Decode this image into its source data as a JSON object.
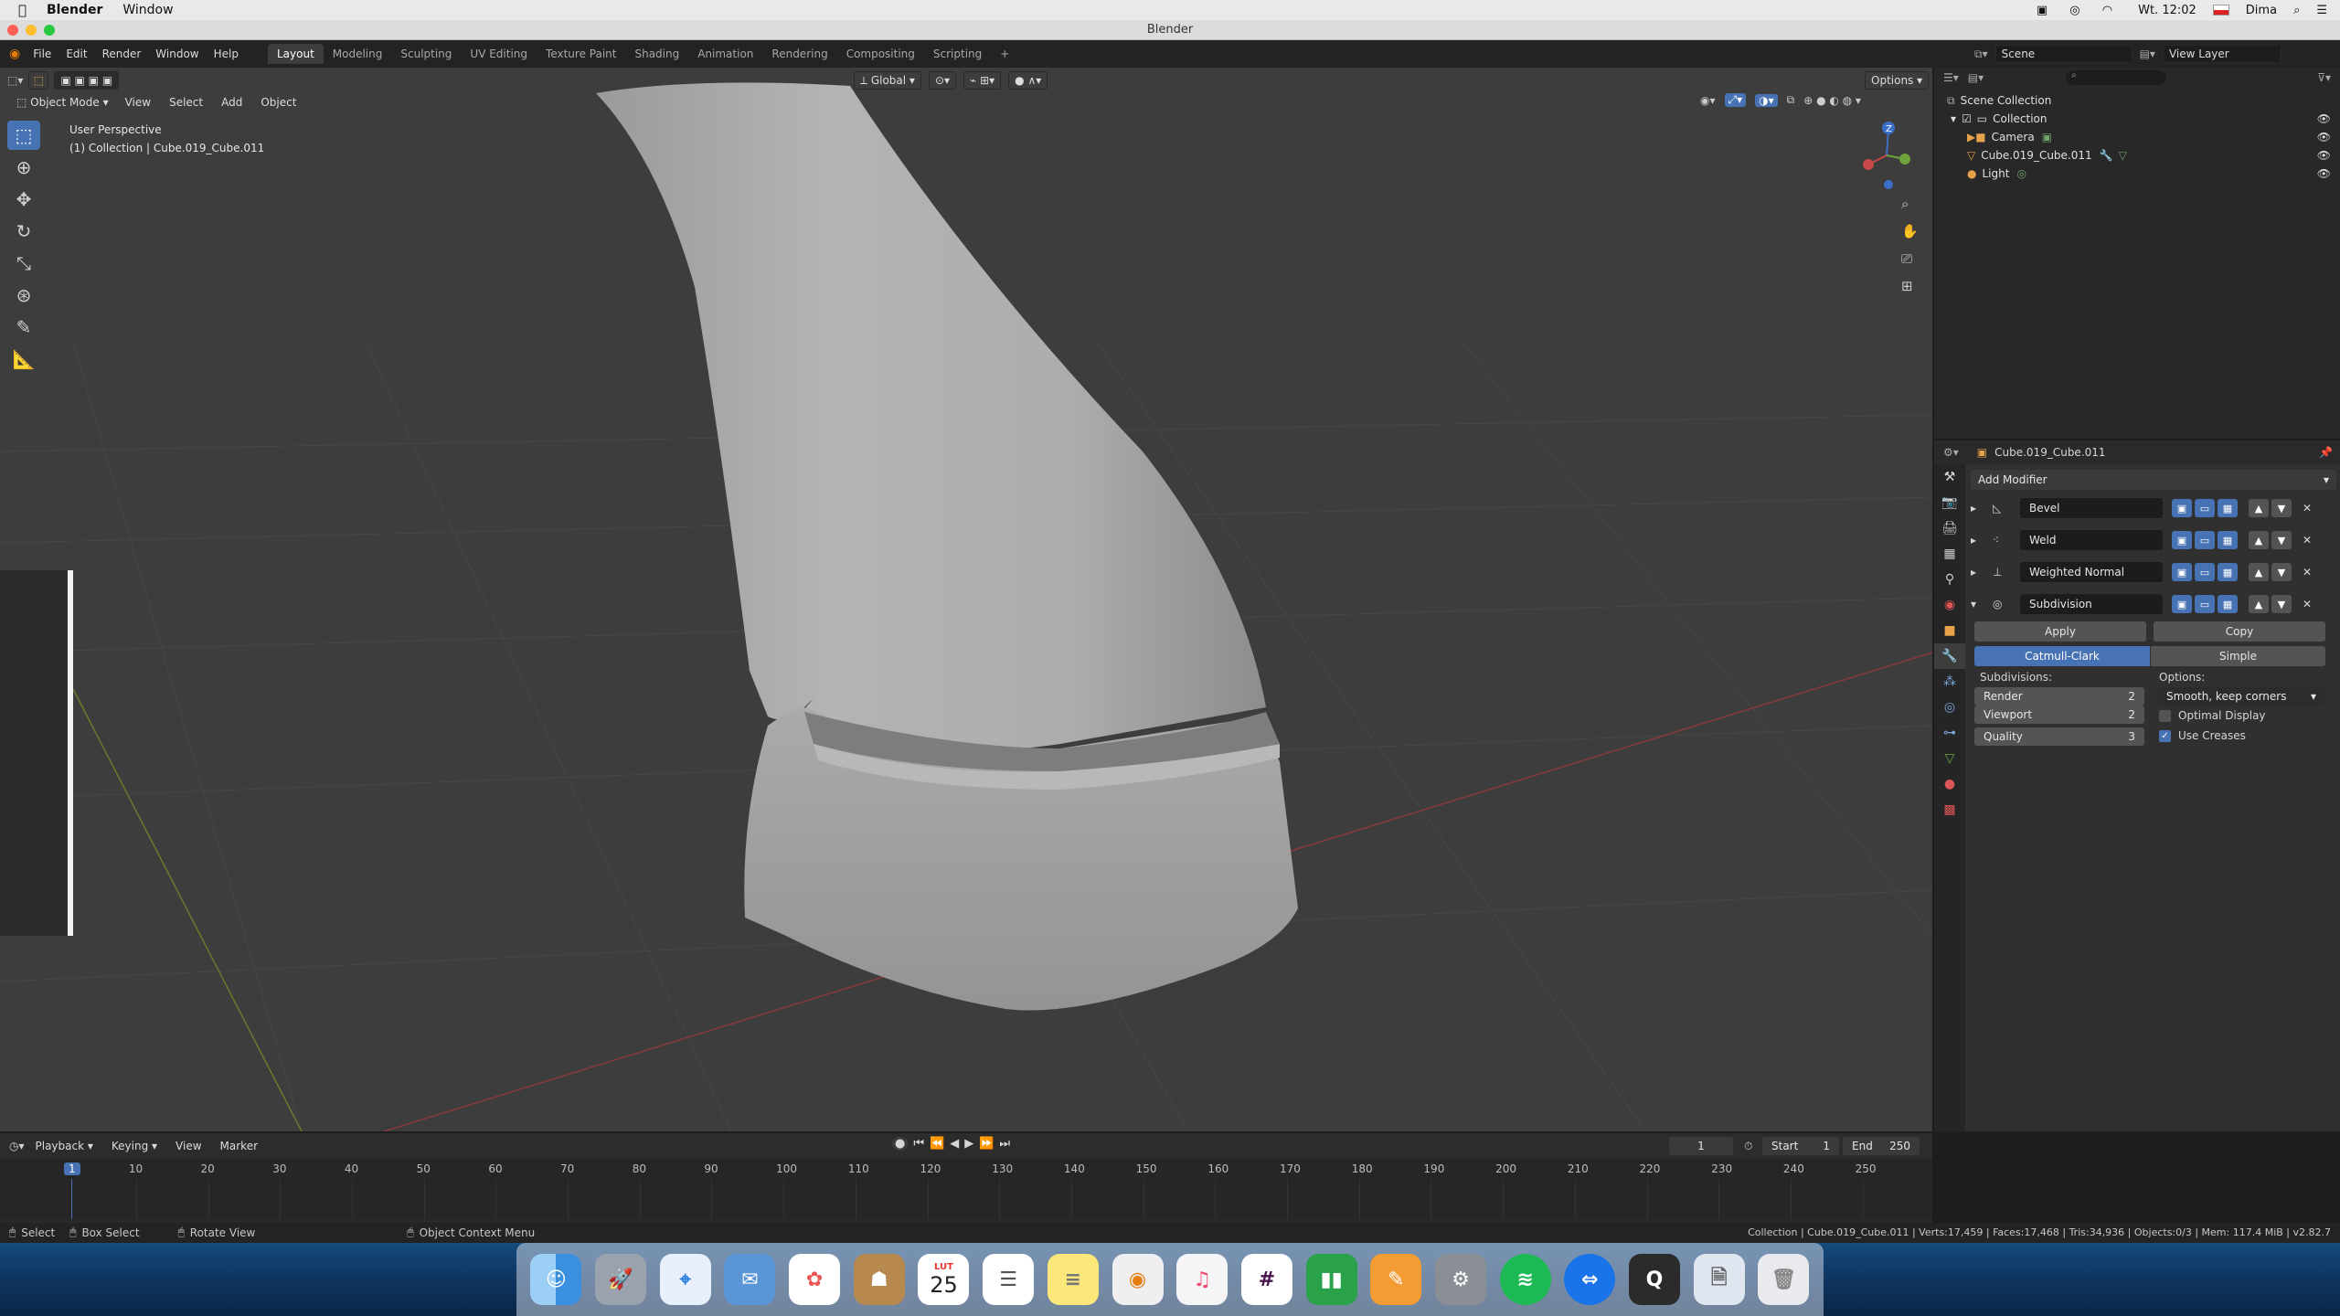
{
  "macos": {
    "app_name": "Blender",
    "menu": [
      "Window"
    ],
    "clock": "Wt. 12:02",
    "user": "Dima"
  },
  "window": {
    "title": "Blender"
  },
  "topbar": {
    "menus": [
      "File",
      "Edit",
      "Render",
      "Window",
      "Help"
    ],
    "workspaces": [
      "Layout",
      "Modeling",
      "Sculpting",
      "UV Editing",
      "Texture Paint",
      "Shading",
      "Animation",
      "Rendering",
      "Compositing",
      "Scripting",
      "+"
    ],
    "active_workspace": "Layout",
    "scene_label": "Scene",
    "view_layer_label": "View Layer"
  },
  "viewport": {
    "mode": "Object Mode",
    "menus": [
      "View",
      "Select",
      "Add",
      "Object"
    ],
    "transform_orientation": "Global",
    "options_label": "Options",
    "info_line1": "User Perspective",
    "info_line2": "(1) Collection | Cube.019_Cube.011",
    "gizmo_z": "Z"
  },
  "outliner": {
    "scene_collection": "Scene Collection",
    "collection": "Collection",
    "items": [
      "Camera",
      "Cube.019_Cube.011",
      "Light"
    ]
  },
  "properties": {
    "object_name": "Cube.019_Cube.011",
    "add_modifier": "Add Modifier",
    "modifiers": [
      "Bevel",
      "Weld",
      "Weighted Normal",
      "Subdivision"
    ],
    "apply_label": "Apply",
    "copy_label": "Copy",
    "algo_catmull": "Catmull-Clark",
    "algo_simple": "Simple",
    "subdivisions_label": "Subdivisions:",
    "options_label": "Options:",
    "render_label": "Render",
    "render_value": "2",
    "viewport_label": "Viewport",
    "viewport_value": "2",
    "quality_label": "Quality",
    "quality_value": "3",
    "uv_smooth": "Smooth, keep corners",
    "optimal_display": "Optimal Display",
    "use_creases": "Use Creases"
  },
  "timeline": {
    "menus": [
      "Playback",
      "Keying",
      "View",
      "Marker"
    ],
    "current_frame": "1",
    "start_label": "Start",
    "start_value": "1",
    "end_label": "End",
    "end_value": "250",
    "ticks": [
      "1",
      "10",
      "20",
      "30",
      "40",
      "50",
      "60",
      "70",
      "80",
      "90",
      "100",
      "110",
      "120",
      "130",
      "140",
      "150",
      "160",
      "170",
      "180",
      "190",
      "200",
      "210",
      "220",
      "230",
      "240",
      "250"
    ]
  },
  "statusbar": {
    "select": "Select",
    "box_select": "Box Select",
    "rotate_view": "Rotate View",
    "context_menu": "Object Context Menu",
    "stats": "Collection | Cube.019_Cube.011 | Verts:17,459 | Faces:17,468 | Tris:34,936 | Objects:0/3 | Mem: 117.4 MiB | v2.82.7"
  },
  "dock": {
    "calendar_month": "LUT",
    "calendar_day": "25"
  },
  "colors": {
    "accent": "#4772b3",
    "viewport_bg": "#3d3d3d",
    "panel_bg": "#303030",
    "red_axis": "#8a3a3a",
    "green_axis": "#6b7a2c"
  }
}
